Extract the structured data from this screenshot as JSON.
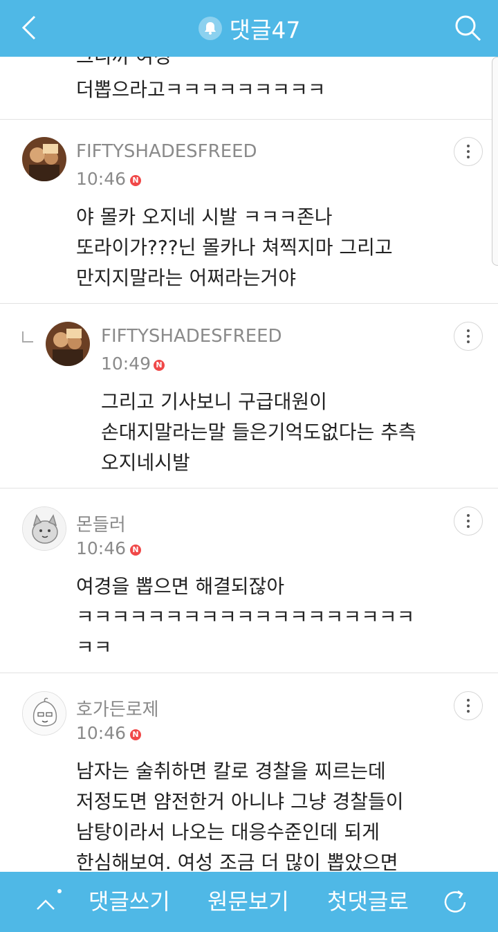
{
  "header": {
    "title": "댓글47",
    "back_icon": "chevron-left-icon",
    "bell_icon": "bell-icon",
    "search_icon": "search-icon",
    "background": "#4fb8e6"
  },
  "partial_comment": {
    "lines": [
      "그니까 여경",
      "더뽑으라고ㅋㅋㅋㅋㅋㅋㅋㅋㅋ"
    ]
  },
  "comments": [
    {
      "username": "FIFTYSHADESFREED",
      "time": "10:46",
      "badge": "N",
      "is_reply": false,
      "lines": [
        "야 몰카 오지네 시발 ㅋㅋㅋ존나",
        "또라이가???닌 몰카나 쳐찍지마 그리고",
        "만지지말라는 어쩌라는거야"
      ]
    },
    {
      "username": "FIFTYSHADESFREED",
      "time": "10:49",
      "badge": "N",
      "is_reply": true,
      "lines": [
        "그리고 기사보니 구급대원이",
        "손대지말라는말 들은기억도없다는 추측",
        "오지네시발"
      ]
    },
    {
      "username": "몬들러",
      "time": "10:46",
      "badge": "N",
      "is_reply": false,
      "lines": [
        "여경을 뽑으면 해결되잖아",
        "ㅋㅋㅋㅋㅋㅋㅋㅋㅋㅋㅋㅋㅋㅋㅋㅋㅋㅋㅋ",
        "ㅋㅋ"
      ]
    },
    {
      "username": "호가든로제",
      "time": "10:46",
      "badge": "N",
      "is_reply": false,
      "lines": [
        "남자는 술취하면 칼로 경찰을 찌르는데",
        "저정도면 얌전한거 아니냐 그냥 경찰들이",
        "남탕이라서 나오는 대응수준인데 되게",
        "한심해보여. 여성 조금 더 많이 뽑았으면"
      ]
    }
  ],
  "bottom_bar": {
    "up_icon": "chevron-up-icon",
    "write_label": "댓글쓰기",
    "original_label": "원문보기",
    "first_label": "첫댓글로",
    "refresh_icon": "refresh-icon"
  }
}
